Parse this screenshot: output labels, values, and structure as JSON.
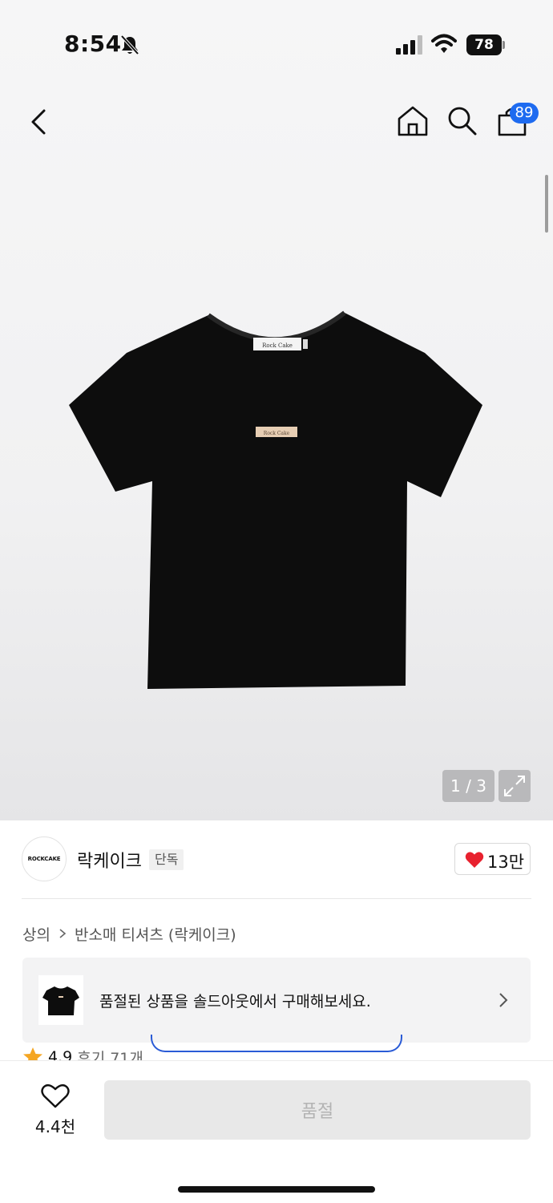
{
  "status": {
    "time": "8:54",
    "battery": "78"
  },
  "nav": {
    "cart_badge": "89"
  },
  "gallery": {
    "pager": "1 / 3",
    "tshirt_label": "Rock Cake"
  },
  "brand": {
    "logo_text": "ROCKCAKE",
    "name": "락케이크",
    "tag": "단독",
    "likes": "13만"
  },
  "breadcrumb": {
    "items": [
      "상의",
      "반소매 티셔츠 (락케이크)"
    ]
  },
  "banner": {
    "text": "품절된 상품을 솔드아웃에서 구매해보세요."
  },
  "rating": {
    "score": "4.9",
    "reviews": "후기 71개"
  },
  "bottom": {
    "wish_count": "4.4천",
    "buy_label": "품절"
  },
  "colors": {
    "accent": "#1e6bf0",
    "heart": "#e8212e",
    "star": "#f5a623",
    "disabled_bg": "#e8e8e8"
  }
}
